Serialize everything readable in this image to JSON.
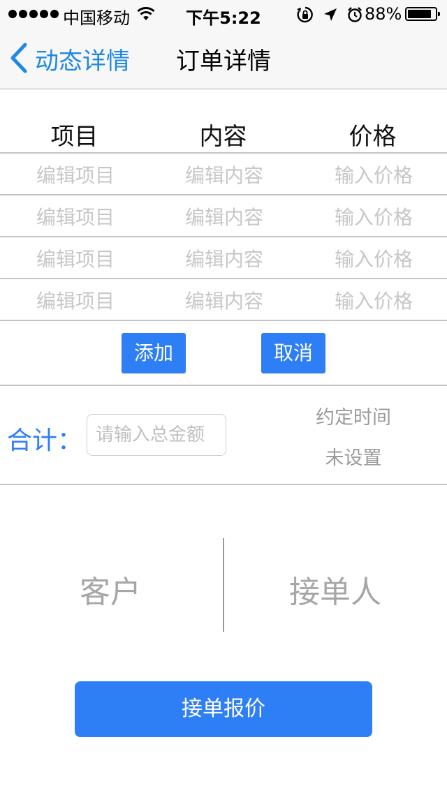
{
  "status_bar": {
    "carrier": "中国移动",
    "time": "下午5:22",
    "battery_percent": "88%",
    "battery_level": 0.88,
    "icons": [
      "signal-dots",
      "wifi-icon",
      "rotation-lock-icon",
      "location-arrow-icon",
      "alarm-icon",
      "battery-icon"
    ]
  },
  "nav": {
    "back_label": "动态详情",
    "title": "订单详情",
    "accent": "#1e88e5"
  },
  "table": {
    "headers": [
      "项目",
      "内容",
      "价格"
    ],
    "rows": [
      {
        "item_placeholder": "编辑项目",
        "content_placeholder": "编辑内容",
        "price_placeholder": "输入价格"
      },
      {
        "item_placeholder": "编辑项目",
        "content_placeholder": "编辑内容",
        "price_placeholder": "输入价格"
      },
      {
        "item_placeholder": "编辑项目",
        "content_placeholder": "编辑内容",
        "price_placeholder": "输入价格"
      },
      {
        "item_placeholder": "编辑项目",
        "content_placeholder": "编辑内容",
        "price_placeholder": "输入价格"
      }
    ]
  },
  "actions": {
    "add_label": "添加",
    "cancel_label": "取消",
    "button_color": "#2e7ef5"
  },
  "total": {
    "label": "合计：",
    "placeholder": "请输入总金额",
    "value": ""
  },
  "appointment": {
    "label": "约定时间",
    "value": "未设置"
  },
  "parties": {
    "customer": "客户",
    "receiver": "接单人"
  },
  "submit": {
    "label": "接单报价"
  }
}
